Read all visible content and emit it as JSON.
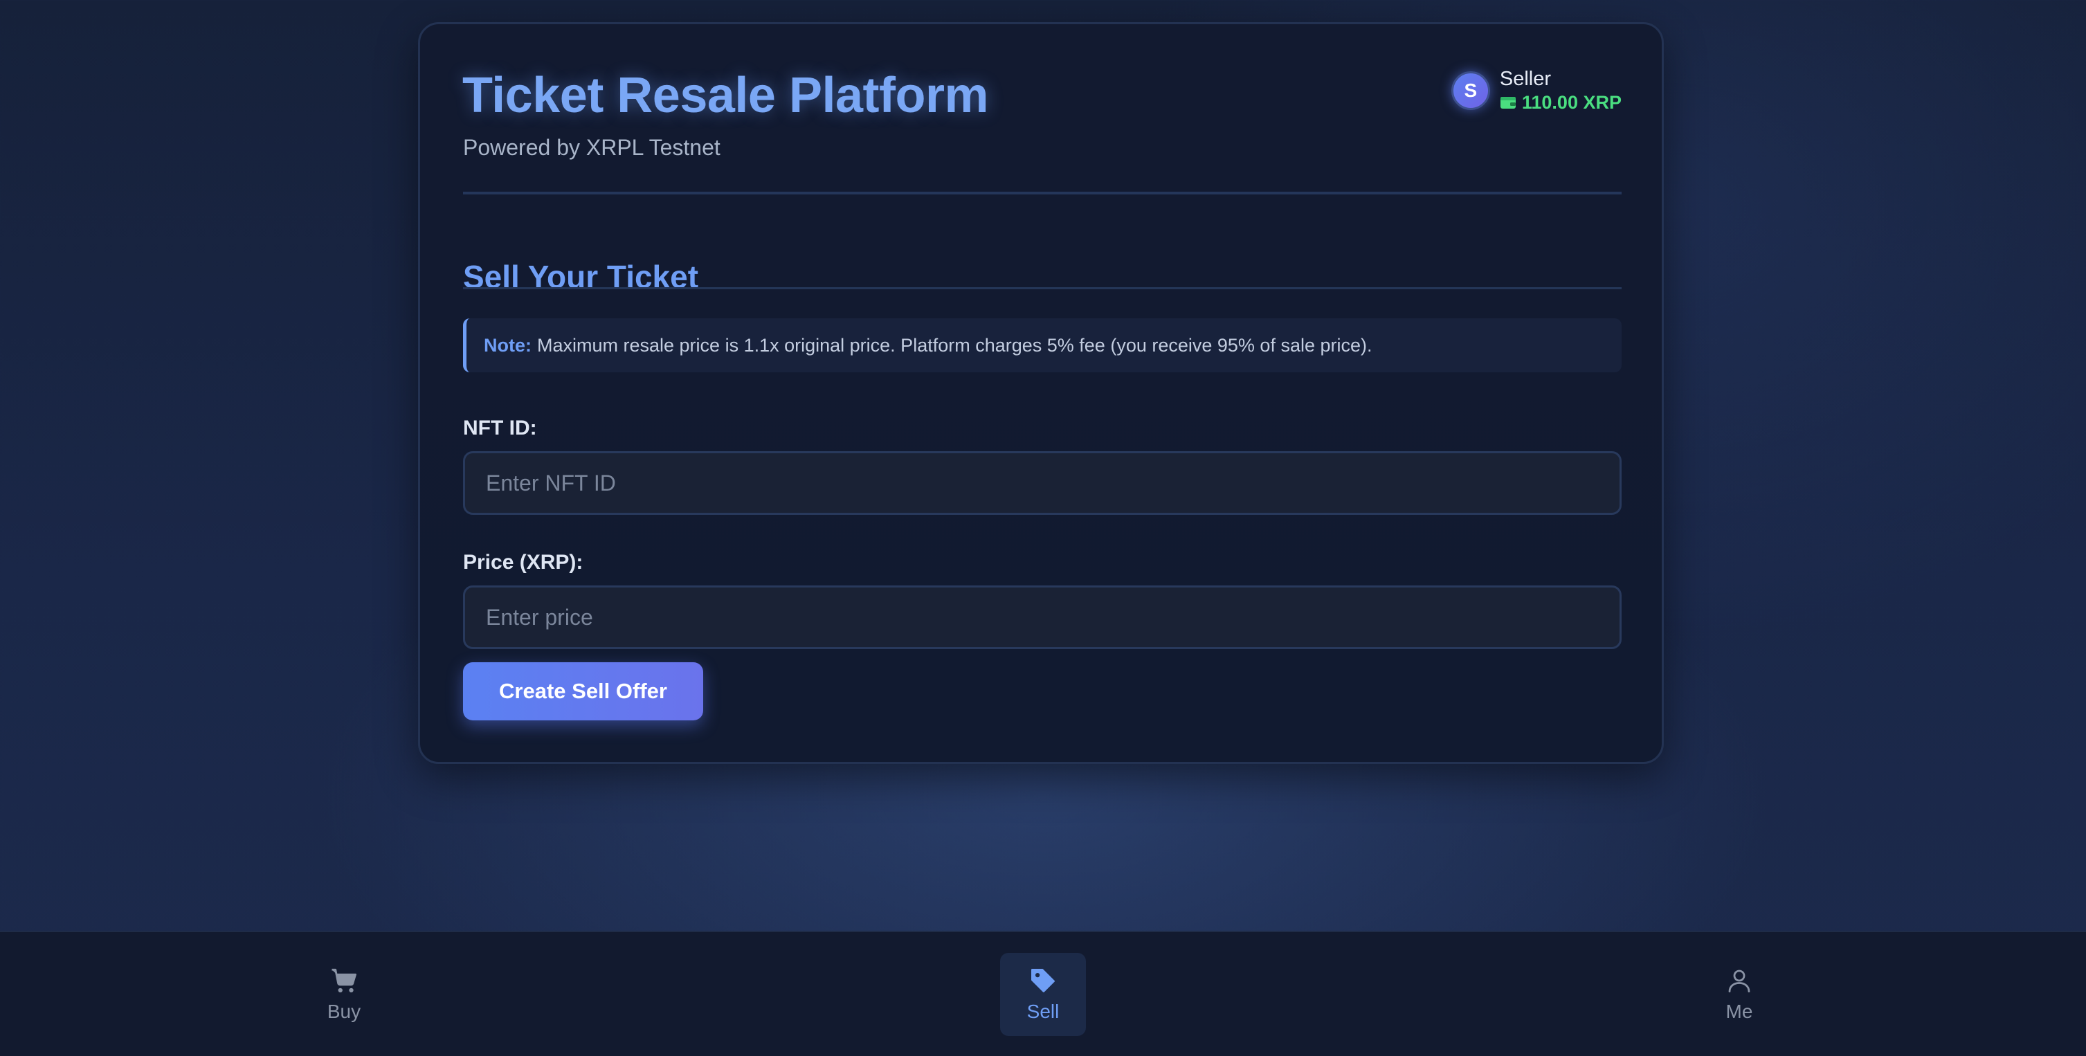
{
  "header": {
    "title": "Ticket Resale Platform",
    "subtitle": "Powered by XRPL Testnet"
  },
  "user": {
    "avatar_initial": "S",
    "role": "Seller",
    "balance": "110.00 XRP",
    "balance_icon": "wallet-icon"
  },
  "sell_form": {
    "section_title": "Sell Your Ticket",
    "note_label": "Note:",
    "note_text": "Maximum resale price is 1.1x original price. Platform charges 5% fee (you receive 95% of sale price).",
    "nft_id_label": "NFT ID:",
    "nft_id_value": "",
    "nft_id_placeholder": "Enter NFT ID",
    "price_label": "Price (XRP):",
    "price_value": "",
    "price_placeholder": "Enter price",
    "submit_label": "Create Sell Offer"
  },
  "bottom_nav": {
    "active": "Sell",
    "items": [
      {
        "label": "Buy",
        "icon": "cart-icon"
      },
      {
        "label": "Sell",
        "icon": "tag-icon"
      },
      {
        "label": "Me",
        "icon": "user-icon"
      }
    ]
  },
  "colors": {
    "accent": "#6f9ef5",
    "balance": "#4ade80",
    "button_start": "#5b81f2",
    "button_end": "#6a73ec"
  }
}
